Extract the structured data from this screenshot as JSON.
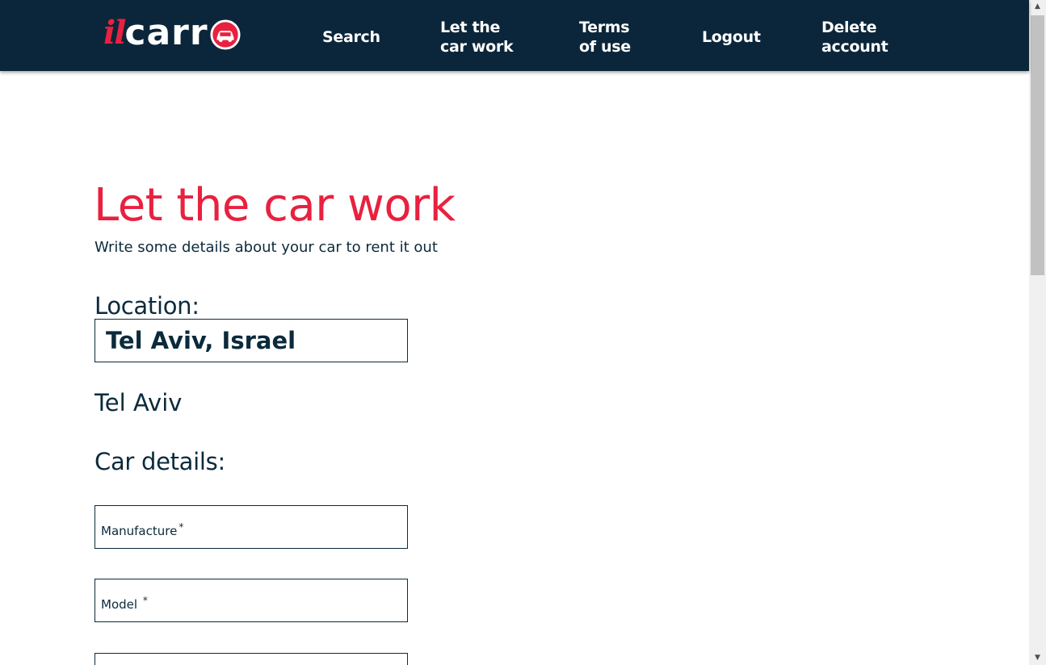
{
  "header": {
    "logo": {
      "il": "il",
      "carr": "carr"
    },
    "nav": {
      "search": "Search",
      "let_car_work_line1": "Let the",
      "let_car_work_line2": "car work",
      "terms_line1": "Terms",
      "terms_line2": "of use",
      "logout": "Logout",
      "delete_line1": "Delete",
      "delete_line2": "account"
    }
  },
  "main": {
    "title": "Let the car work",
    "subtitle": "Write some details about your car to rent it out",
    "location_label": "Location:",
    "location_value": "Tel Aviv, Israel",
    "city": "Tel Aviv",
    "car_details_label": "Car details:",
    "fields": {
      "manufacture": "Manufacture",
      "model": "Model",
      "required_mark": "*"
    }
  },
  "colors": {
    "header_bg": "#0b263a",
    "accent_red": "#e8213f",
    "text_dark": "#0b2a3c"
  },
  "icons": {
    "logo_circle": "car-icon",
    "scroll_up": "arrow-up-icon",
    "scroll_down": "arrow-down-icon"
  }
}
